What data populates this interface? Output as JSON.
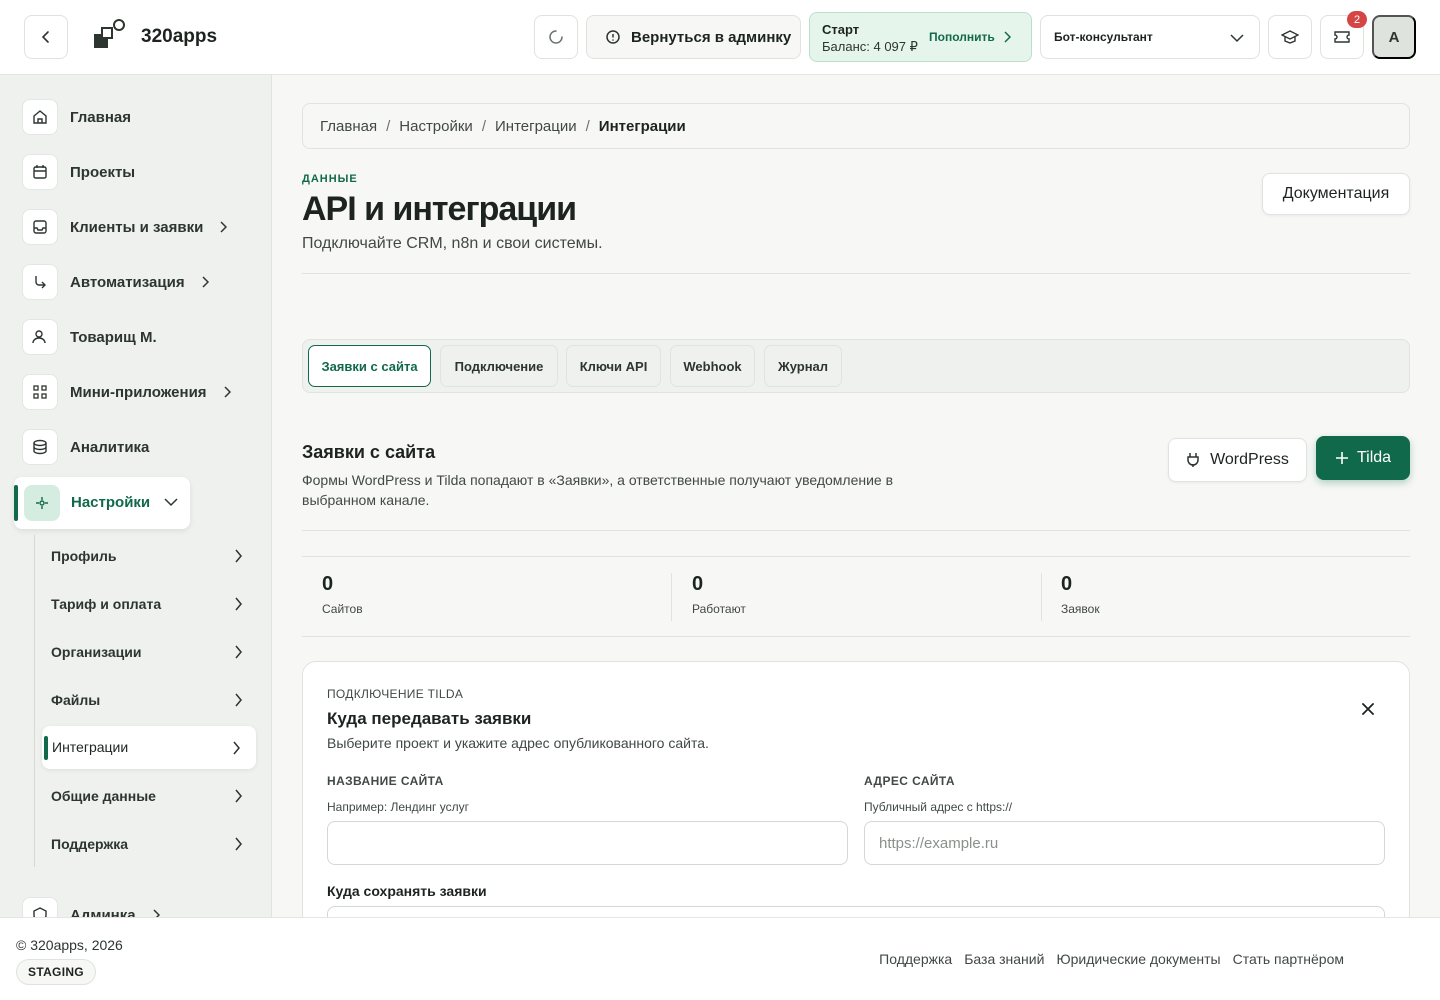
{
  "header": {
    "app_name": "320apps",
    "admin_button": "Вернуться в админку",
    "plan": {
      "name": "Старт",
      "balance": "Баланс: 4 097 ₽",
      "topup": "Пополнить"
    },
    "bot_select": "Бот-консультант",
    "notifications_count": "2",
    "avatar_initial": "A"
  },
  "sidebar": {
    "items": [
      {
        "label": "Главная",
        "icon": "home-icon"
      },
      {
        "label": "Проекты",
        "icon": "calendar-icon"
      },
      {
        "label": "Клиенты и заявки",
        "icon": "inbox-icon"
      },
      {
        "label": "Автоматизация",
        "icon": "automation-icon"
      },
      {
        "label": "Товарищ М.",
        "icon": "user-icon"
      },
      {
        "label": "Мини-приложения",
        "icon": "apps-icon"
      },
      {
        "label": "Аналитика",
        "icon": "database-icon"
      }
    ],
    "active": {
      "label": "Настройки",
      "icon": "settings-icon"
    },
    "sub_items": [
      "Профиль",
      "Тариф и оплата",
      "Организации",
      "Файлы",
      "Интеграции",
      "Общие данные",
      "Поддержка"
    ],
    "partial_item": "Админка"
  },
  "breadcrumb": [
    "Главная",
    "Настройки",
    "Интеграции",
    "Интеграции"
  ],
  "page": {
    "eyebrow": "ДАННЫЕ",
    "title": "API и интеграции",
    "subtitle": "Подключайте CRM, n8n и свои системы.",
    "docs_button": "Документация"
  },
  "tabs": [
    "Заявки с сайта",
    "Подключение",
    "Ключи API",
    "Webhook",
    "Журнал"
  ],
  "section": {
    "title": "Заявки с сайта",
    "description": "Формы WordPress и Tilda попадают в «Заявки», а ответственные получают уведомление в выбранном канале.",
    "wp_button": "WordPress",
    "tilda_button": "Tilda"
  },
  "stats": [
    {
      "value": "0",
      "label": "Сайтов"
    },
    {
      "value": "0",
      "label": "Работают"
    },
    {
      "value": "0",
      "label": "Заявок"
    }
  ],
  "form": {
    "eyebrow": "ПОДКЛЮЧЕНИЕ TILDA",
    "title": "Куда передавать заявки",
    "description": "Выберите проект и укажите адрес опубликованного сайта.",
    "name_label": "НАЗВАНИЕ САЙТА",
    "name_hint": "Например: Лендинг услуг",
    "name_value": "",
    "url_label": "АДРЕС САЙТА",
    "url_hint": "Публичный адрес с https://",
    "url_placeholder": "https://example.ru",
    "save_label": "Куда сохранять заявки"
  },
  "footer": {
    "copyright": "© 320apps, 2026",
    "env": "STAGING",
    "links": [
      "Поддержка",
      "База знаний",
      "Юридические документы",
      "Стать партнёром"
    ]
  }
}
